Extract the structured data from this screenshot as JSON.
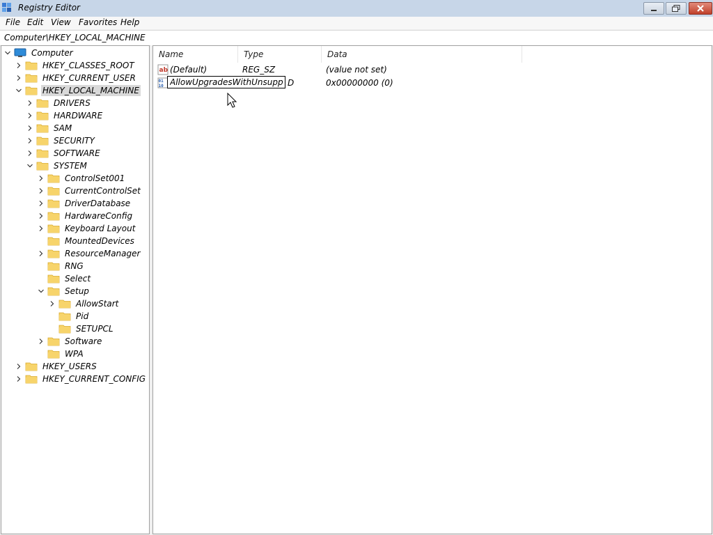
{
  "window": {
    "title": "Registry Editor"
  },
  "menu": [
    "File",
    "Edit",
    "View",
    "Favorites",
    "Help"
  ],
  "address": "Computer\\HKEY_LOCAL_MACHINE",
  "tree": [
    {
      "label": "Computer",
      "expanded": true
    },
    {
      "label": "HKEY_CLASSES_ROOT"
    },
    {
      "label": "HKEY_CURRENT_USER"
    },
    {
      "label": "HKEY_LOCAL_MACHINE",
      "expanded": true,
      "selected": true
    },
    {
      "label": "DRIVERS"
    },
    {
      "label": "HARDWARE"
    },
    {
      "label": "SAM"
    },
    {
      "label": "SECURITY"
    },
    {
      "label": "SOFTWARE"
    },
    {
      "label": "SYSTEM",
      "expanded": true
    },
    {
      "label": "ControlSet001"
    },
    {
      "label": "CurrentControlSet"
    },
    {
      "label": "DriverDatabase"
    },
    {
      "label": "HardwareConfig"
    },
    {
      "label": "Keyboard Layout"
    },
    {
      "label": "MountedDevices"
    },
    {
      "label": "ResourceManager"
    },
    {
      "label": "RNG"
    },
    {
      "label": "Select"
    },
    {
      "label": "Setup",
      "expanded": true
    },
    {
      "label": "AllowStart"
    },
    {
      "label": "Pid"
    },
    {
      "label": "SETUPCL"
    },
    {
      "label": "Software"
    },
    {
      "label": "WPA"
    },
    {
      "label": "HKEY_USERS"
    },
    {
      "label": "HKEY_CURRENT_CONFIG"
    }
  ],
  "columns": {
    "name": "Name",
    "type": "Type",
    "data": "Data"
  },
  "values": [
    {
      "name": "(Default)",
      "type": "REG_SZ",
      "data": "(value not set)",
      "icon": "string-value-icon"
    },
    {
      "name": "",
      "type": "D",
      "data": "0x00000000 (0)",
      "icon": "dword-value-icon"
    }
  ],
  "rename_value": "AllowUpgradesWithUnsuppo",
  "colors": {
    "folder": "#f7d46b",
    "folder_edge": "#d9a928",
    "selection": "#d9d9d9",
    "titlebar": "#c7d6e8"
  }
}
